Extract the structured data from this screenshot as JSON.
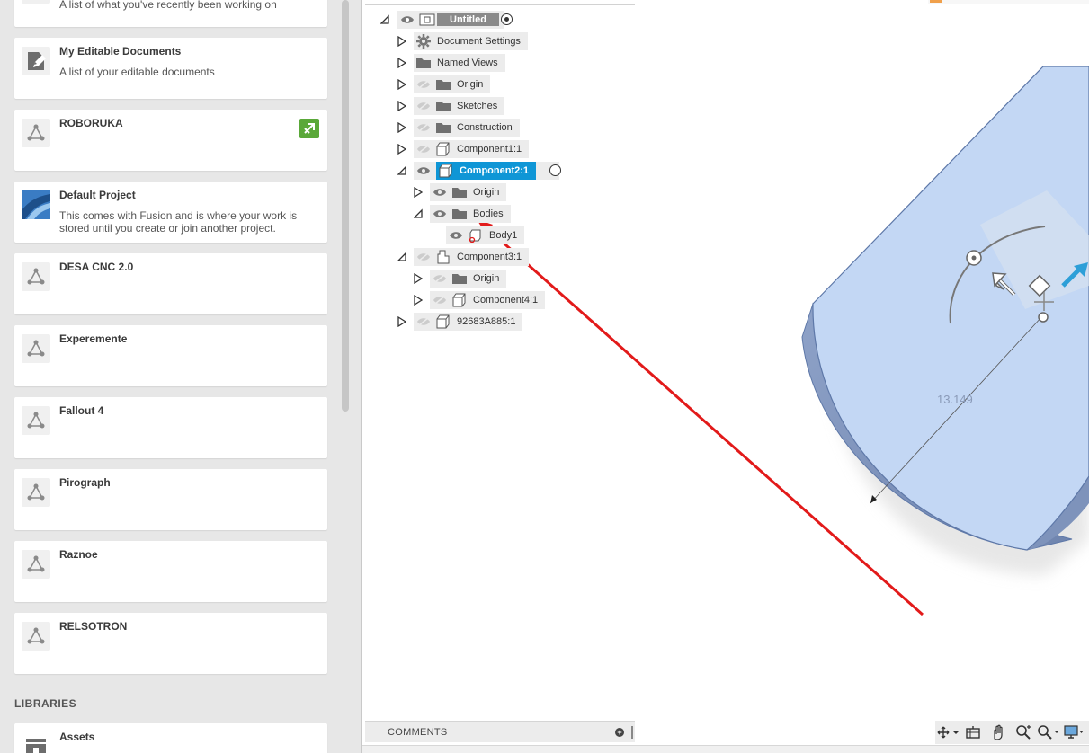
{
  "data_panel": {
    "partial_card": {
      "desc": "A list of what you've recently been working on"
    },
    "cards": [
      {
        "name": "my-editable-documents",
        "title": "My Editable Documents",
        "desc": "A list of your editable documents",
        "icon": "pencil-doc-icon"
      },
      {
        "name": "roboruka",
        "title": "ROBORUKA",
        "desc": "",
        "icon": "project-icon",
        "badge": "shared-project-icon"
      },
      {
        "name": "default-project",
        "title": "Default Project",
        "desc": "This comes with Fusion and is where your work is stored until you create or join another project.",
        "icon": "fusion-project-icon"
      },
      {
        "name": "desa-cnc",
        "title": "DESA CNC 2.0",
        "desc": "",
        "icon": "project-icon"
      },
      {
        "name": "experemente",
        "title": "Experemente",
        "desc": "",
        "icon": "project-icon"
      },
      {
        "name": "fallout-4",
        "title": "Fallout 4",
        "desc": "",
        "icon": "project-icon"
      },
      {
        "name": "pirograph",
        "title": "Pirograph",
        "desc": "",
        "icon": "project-icon"
      },
      {
        "name": "raznoe",
        "title": "Raznoe",
        "desc": "",
        "icon": "project-icon"
      },
      {
        "name": "relsotron",
        "title": "RELSOTRON",
        "desc": "",
        "icon": "project-icon"
      }
    ],
    "libraries_heading": "LIBRARIES",
    "library_cards": [
      {
        "name": "assets",
        "title": "Assets",
        "icon": "library-icon"
      }
    ]
  },
  "browser": {
    "root": "Untitled",
    "nodes": {
      "document_settings": "Document Settings",
      "named_views": "Named Views",
      "origin": "Origin",
      "sketches": "Sketches",
      "construction": "Construction",
      "component1": "Component1:1",
      "component2": "Component2:1",
      "c2_origin": "Origin",
      "c2_bodies": "Bodies",
      "body1": "Body1",
      "component3": "Component3:1",
      "c3_origin": "Origin",
      "component4": "Component4:1",
      "part_92683": "92683A885:1"
    }
  },
  "viewport": {
    "dimension_label": "13.149",
    "body_color": "#c3d7f4",
    "edge_color": "#5e78a8",
    "annotation_arrow_color": "#e21a1a",
    "manipulator_color": "#2d9fd8"
  },
  "comments": {
    "label": "COMMENTS"
  },
  "nav_bar": {
    "buttons": [
      "orbit-icon",
      "look-at-icon",
      "pan-icon",
      "zoom-fit-icon",
      "zoom-window-icon",
      "display-settings-icon"
    ]
  }
}
